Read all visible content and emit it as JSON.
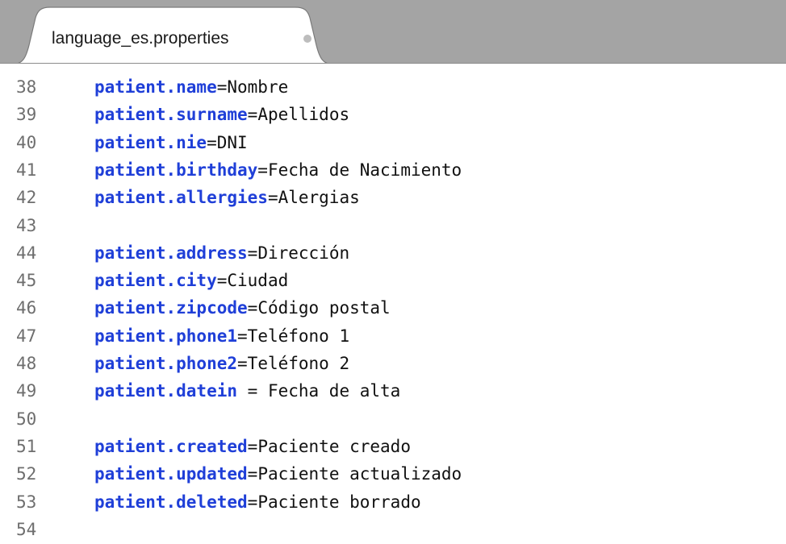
{
  "tab": {
    "title": "language_es.properties",
    "status_icon": "modified-dot-icon"
  },
  "editor": {
    "partial_top_line": "37",
    "lines": [
      {
        "num": "38",
        "key": "patient.name",
        "sep": "=",
        "value": "Nombre"
      },
      {
        "num": "39",
        "key": "patient.surname",
        "sep": "=",
        "value": "Apellidos"
      },
      {
        "num": "40",
        "key": "patient.nie",
        "sep": "=",
        "value": "DNI"
      },
      {
        "num": "41",
        "key": "patient.birthday",
        "sep": "=",
        "value": "Fecha de Nacimiento"
      },
      {
        "num": "42",
        "key": "patient.allergies",
        "sep": "=",
        "value": "Alergias"
      },
      {
        "num": "43",
        "key": "",
        "sep": "",
        "value": ""
      },
      {
        "num": "44",
        "key": "patient.address",
        "sep": "=",
        "value": "Dirección"
      },
      {
        "num": "45",
        "key": "patient.city",
        "sep": "=",
        "value": "Ciudad"
      },
      {
        "num": "46",
        "key": "patient.zipcode",
        "sep": "=",
        "value": "Código postal"
      },
      {
        "num": "47",
        "key": "patient.phone1",
        "sep": "=",
        "value": "Teléfono 1"
      },
      {
        "num": "48",
        "key": "patient.phone2",
        "sep": "=",
        "value": "Teléfono 2"
      },
      {
        "num": "49",
        "key": "patient.datein",
        "sep": " = ",
        "value": "Fecha de alta"
      },
      {
        "num": "50",
        "key": "",
        "sep": "",
        "value": ""
      },
      {
        "num": "51",
        "key": "patient.created",
        "sep": "=",
        "value": "Paciente creado"
      },
      {
        "num": "52",
        "key": "patient.updated",
        "sep": "=",
        "value": "Paciente actualizado"
      },
      {
        "num": "53",
        "key": "patient.deleted",
        "sep": "=",
        "value": "Paciente borrado"
      },
      {
        "num": "54",
        "key": "",
        "sep": "",
        "value": ""
      }
    ]
  },
  "colors": {
    "key": "#1f3fd8",
    "line_number": "#6e6e6e",
    "tabbar": "#a4a4a4"
  }
}
